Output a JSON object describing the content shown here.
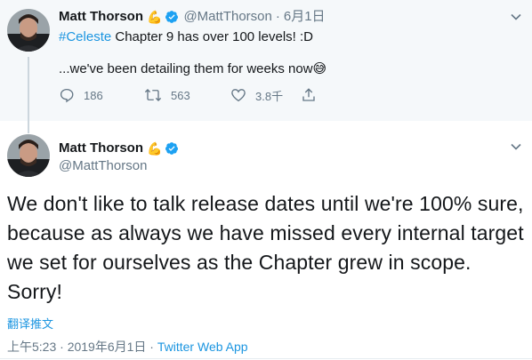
{
  "parent_tweet": {
    "author_name": "Matt Thorson",
    "name_icon": "flexed-biceps-emoji",
    "verified": true,
    "handle": "@MattThorson",
    "separator": "·",
    "date": "6月1日",
    "hashtag": "#Celeste",
    "text_line1_rest": " Chapter 9 has over 100 levels! :D",
    "text_line2": "...we've been detailing them for weeks now",
    "text_line2_emoji": "😅",
    "actions": {
      "reply_count": "186",
      "retweet_count": "563",
      "like_count": "3.8千"
    }
  },
  "main_tweet": {
    "author_name": "Matt Thorson",
    "name_icon": "flexed-biceps-emoji",
    "verified": true,
    "handle": "@MattThorson",
    "body": "We don't like to talk release dates until we're 100% sure, because as always we have missed every internal target we set for ourselves as the Chapter grew in scope. Sorry!",
    "translate_label": "翻译推文",
    "timestamp": "上午5:23 · 2019年6月1日 · ",
    "via": "Twitter Web App"
  },
  "colors": {
    "link_blue": "#1b95e0",
    "secondary_gray": "#657786",
    "parent_bg": "#f5f8fa",
    "verified_blue": "#1da1f2"
  }
}
